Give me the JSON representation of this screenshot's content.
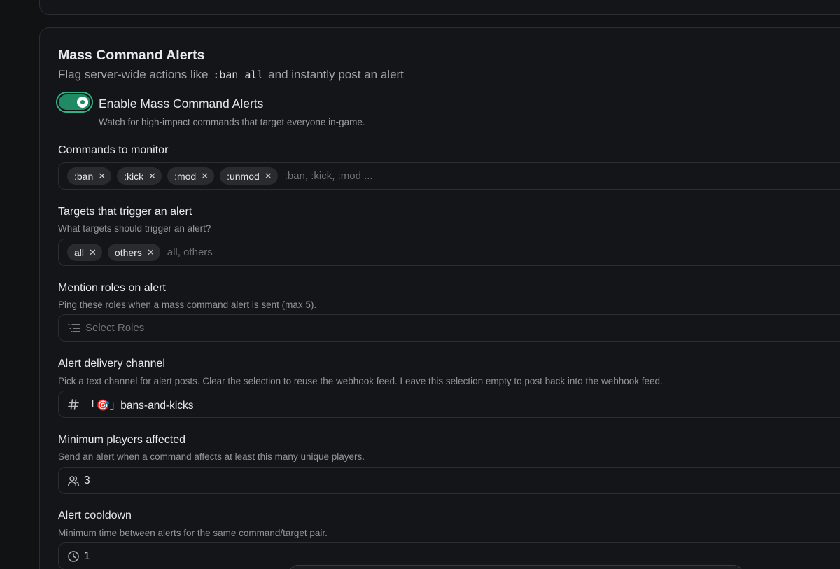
{
  "section": {
    "title": "Mass Command Alerts",
    "desc_before": "Flag server-wide actions like ",
    "desc_code": ":ban all",
    "desc_after": " and instantly post an alert"
  },
  "toggle": {
    "label": "Enable Mass Command Alerts",
    "description": "Watch for high-impact commands that target everyone in-game.",
    "enabled": true
  },
  "commands": {
    "label": "Commands to monitor",
    "chips": [
      ":ban",
      ":kick",
      ":mod",
      ":unmod"
    ],
    "placeholder": ":ban, :kick, :mod ..."
  },
  "targets": {
    "label": "Targets that trigger an alert",
    "help": "What targets should trigger an alert?",
    "chips": [
      "all",
      "others"
    ],
    "placeholder": "all, others"
  },
  "roles": {
    "label": "Mention roles on alert",
    "help": "Ping these roles when a mass command alert is sent (max 5).",
    "placeholder": "Select Roles"
  },
  "channel": {
    "label": "Alert delivery channel",
    "help": "Pick a text channel for alert posts. Clear the selection to reuse the webhook feed. Leave this selection empty to post back into the webhook feed.",
    "value": "「🎯」bans-and-kicks"
  },
  "min_players": {
    "label": "Minimum players affected",
    "help": "Send an alert when a command affects at least this many unique players.",
    "value": "3"
  },
  "cooldown": {
    "label": "Alert cooldown",
    "help": "Minimum time between alerts for the same command/target pair.",
    "value": "1"
  },
  "colors": {
    "accent": "#1f8a63",
    "accent_ring": "#2fb386",
    "background": "#111214",
    "card": "#141518"
  },
  "icons": {
    "chip_remove": "close-icon",
    "roles": "list-filter-icon",
    "channel": "hash-icon",
    "players": "users-icon",
    "cooldown": "clock-icon"
  }
}
